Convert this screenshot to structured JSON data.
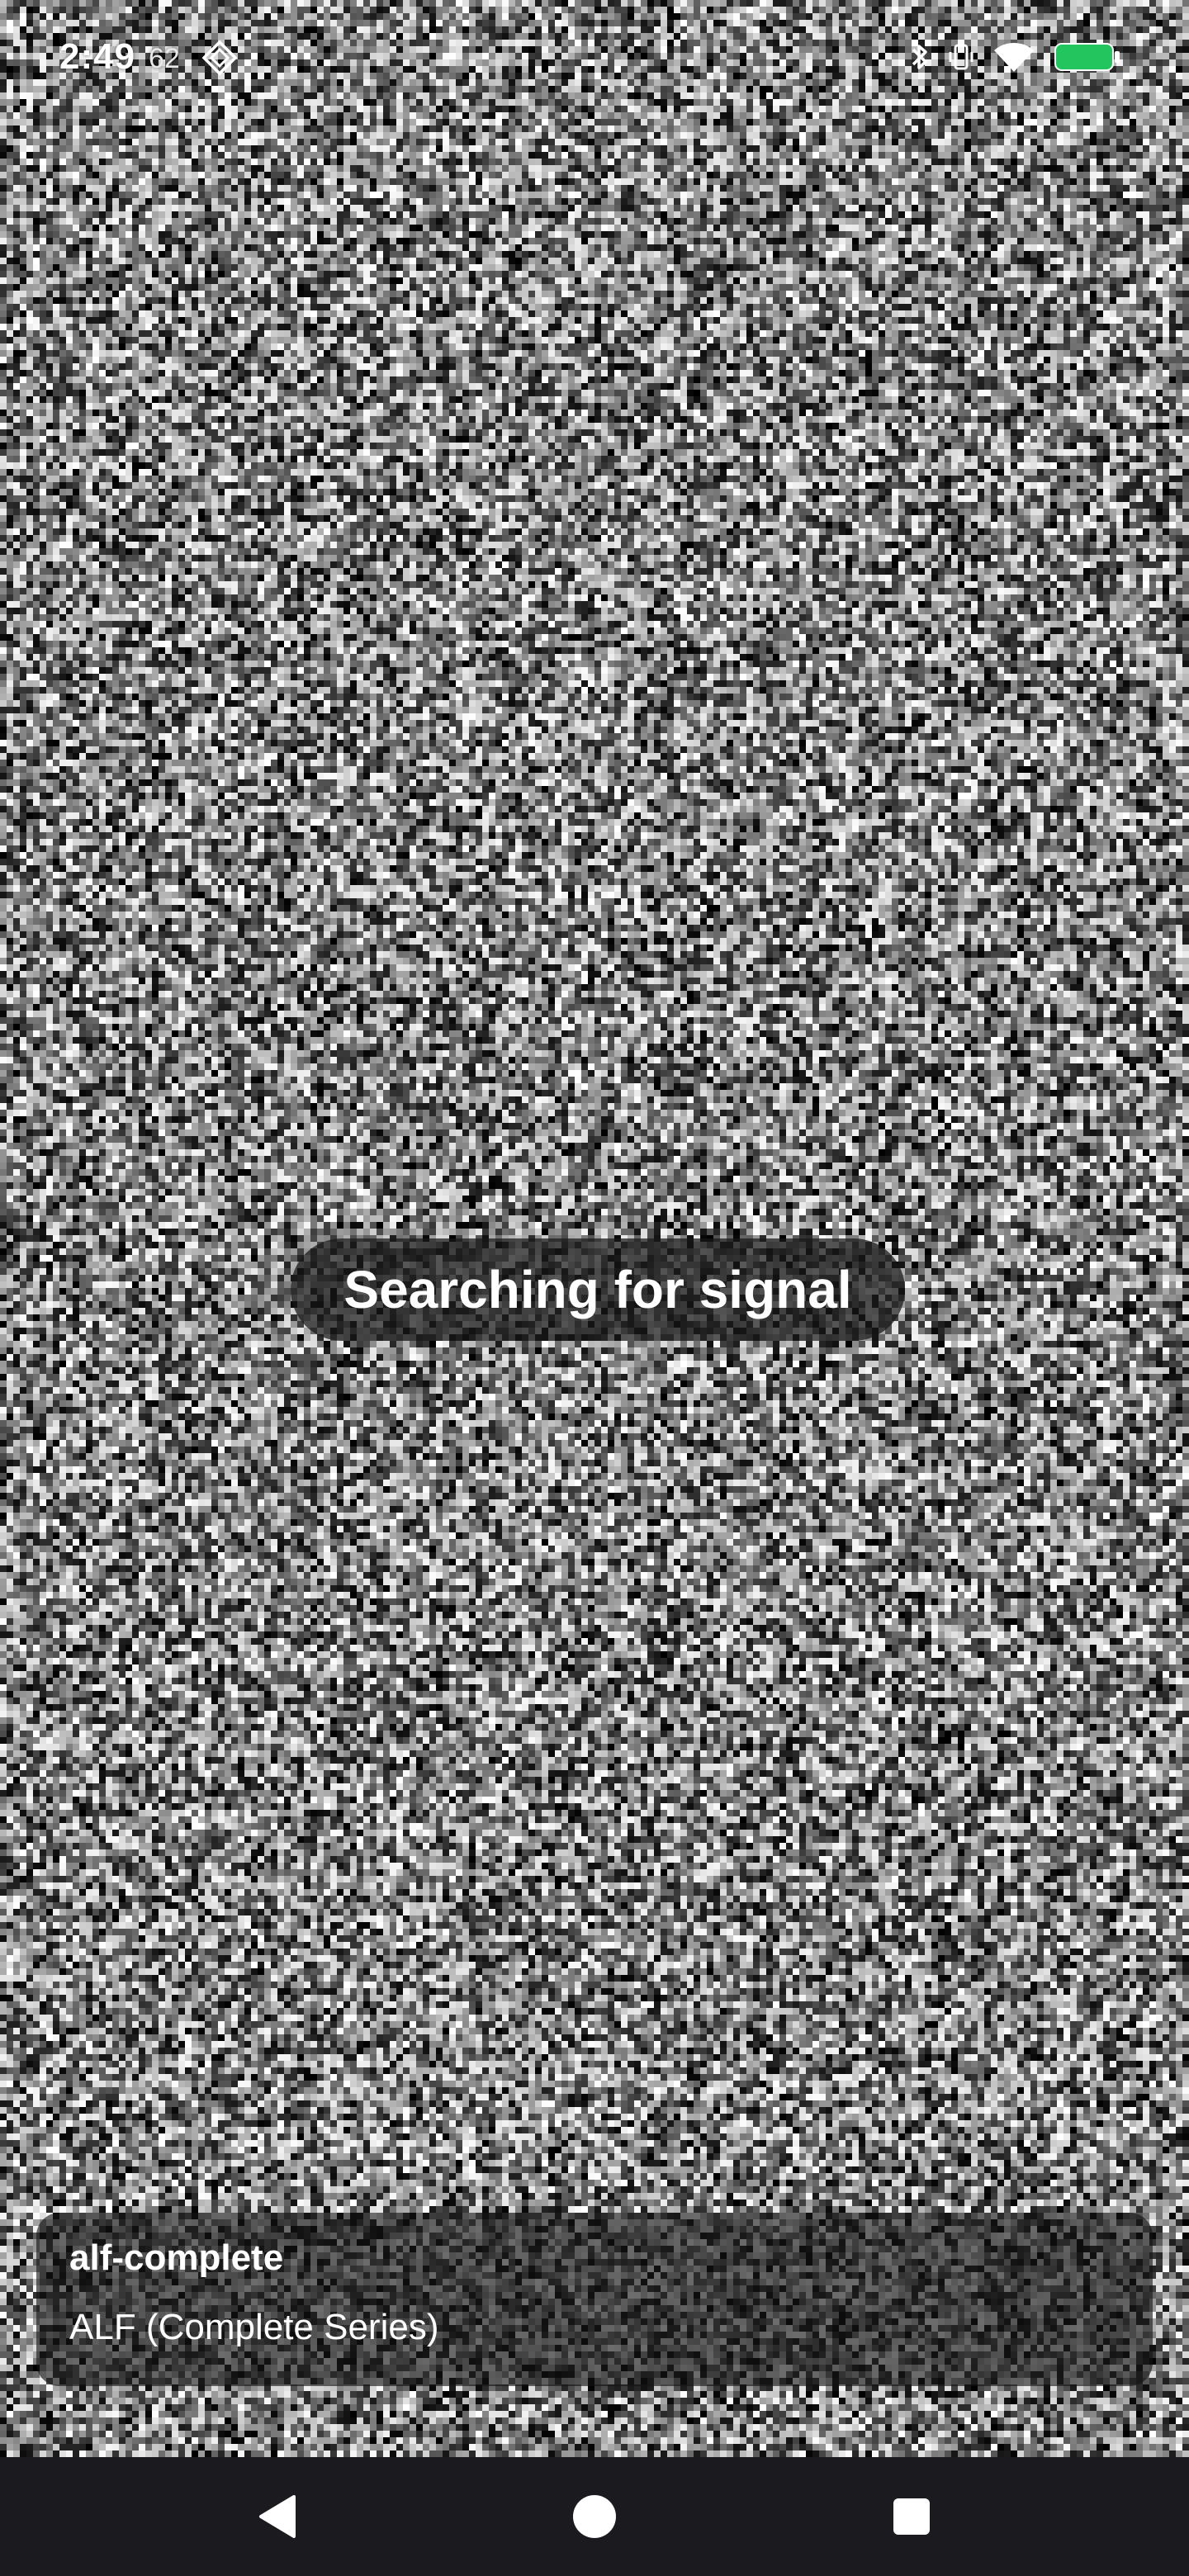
{
  "status_bar": {
    "time": "2:49",
    "temperature": "62",
    "app_icon": "diamond-app-icon",
    "icons": [
      "bluetooth-icon",
      "vibrate-icon",
      "wifi-icon",
      "battery-icon"
    ],
    "battery_color": "#22c55e"
  },
  "toast": {
    "message": "Searching for signal"
  },
  "now_playing": {
    "channel_id": "alf-complete",
    "title": "ALF (Complete Series)"
  },
  "nav_bar": {
    "icons": [
      "back-icon",
      "home-icon",
      "recents-icon"
    ]
  },
  "colors": {
    "nav_background": "#1b1b1f",
    "overlay": "rgba(24,24,24,0.72)"
  }
}
